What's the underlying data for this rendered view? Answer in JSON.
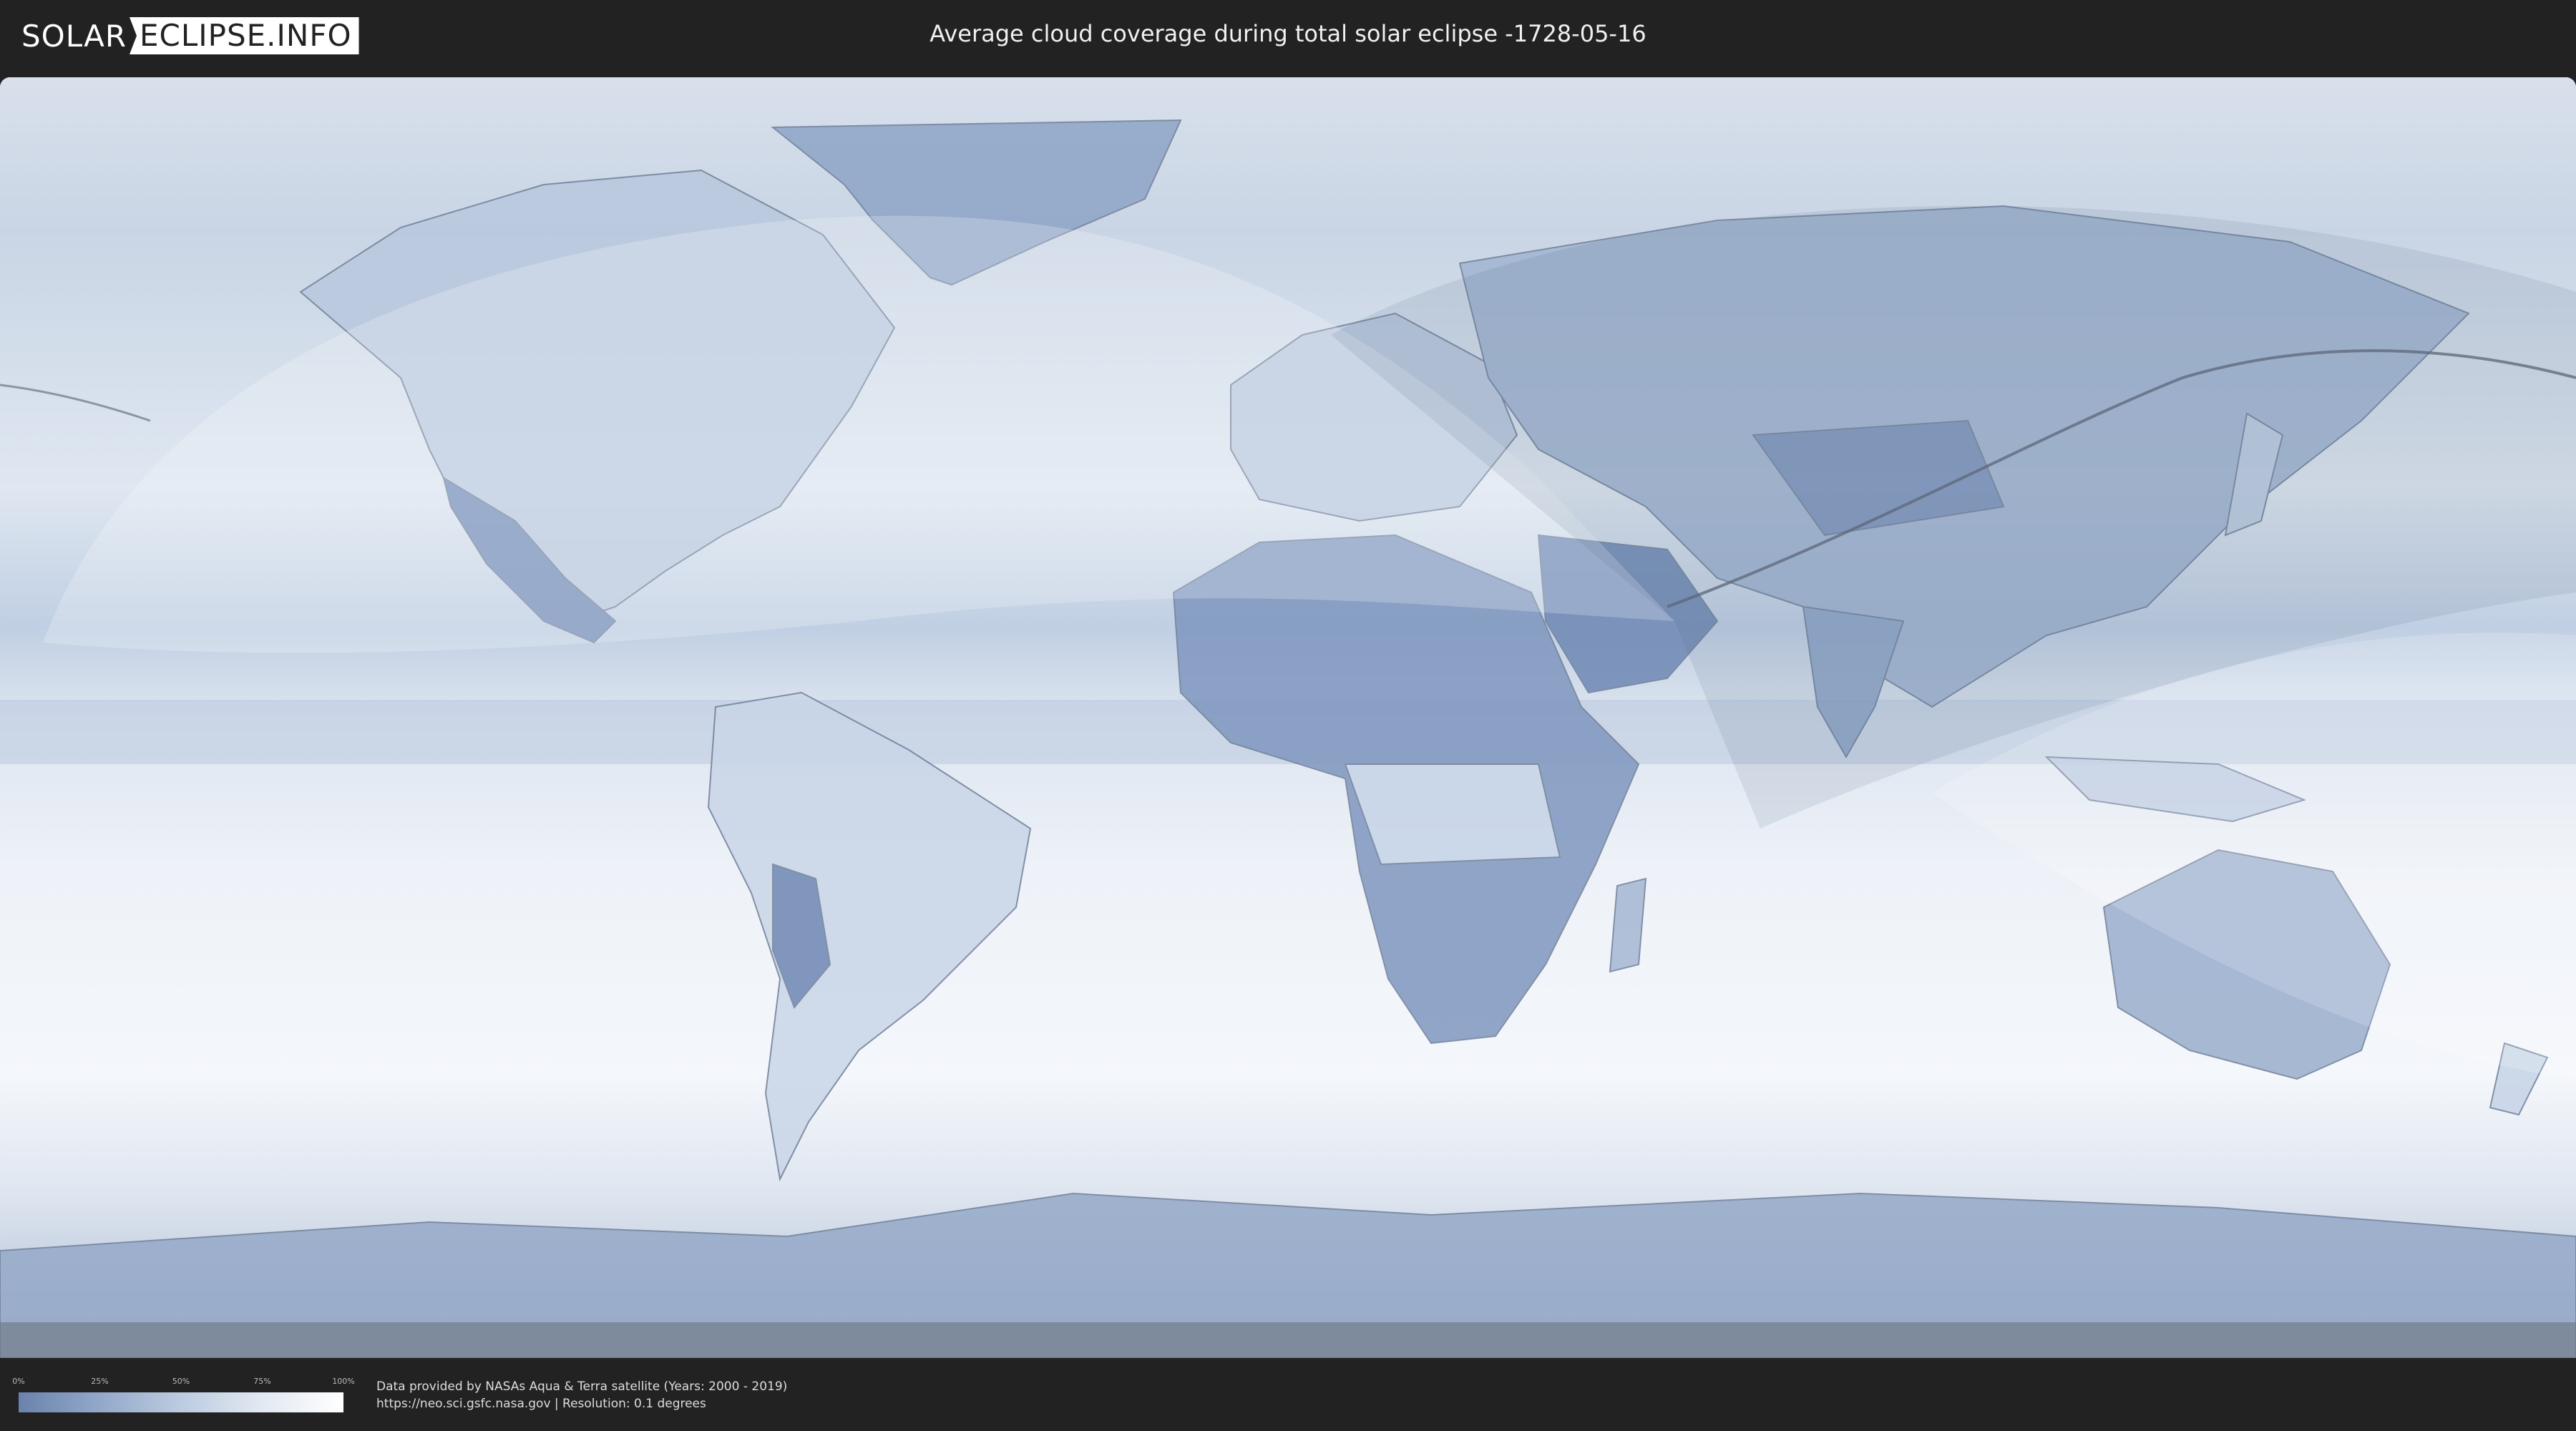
{
  "header": {
    "logo_left": "SOLAR",
    "logo_right": "ECLIPSE.INFO",
    "title": "Average cloud coverage during total solar eclipse -1728-05-16"
  },
  "legend": {
    "ticks": [
      "0%",
      "25%",
      "50%",
      "75%",
      "100%"
    ],
    "scale_min": 0,
    "scale_max": 100,
    "color_low": "#6a82ad",
    "color_high": "#ffffff"
  },
  "credits": {
    "line1": "Data provided by NASAs Aqua & Terra satellite (Years: 2000 - 2019)",
    "line2": "https://neo.sci.gsfc.nasa.gov | Resolution: 0.1 degrees"
  },
  "colors": {
    "background": "#222222",
    "ocean_cloud": "#e3e9f2",
    "land_clear": "#7f97bf",
    "eclipse_path": "#6b7585"
  }
}
